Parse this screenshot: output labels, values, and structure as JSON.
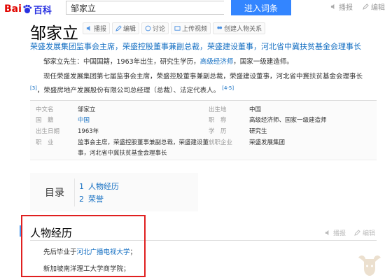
{
  "header": {
    "logo_bai": "Bai",
    "logo_baike": "百科",
    "search_value": "邹家立",
    "search_button": "进入词条",
    "actions": [
      "播报",
      "编辑"
    ]
  },
  "entry": {
    "title": "邹家立",
    "tools": [
      "播报",
      "编辑",
      "讨论",
      "上传视频",
      "创建人物关系"
    ],
    "subtitle": "荣盛发展集团监事会主席，荣盛控股董事兼副总裁，荣盛建设董事，河北省中冀扶贫基金会理事长",
    "para1_prefix": "邹家立先生：中国国籍，1963年出生，研究生学历，",
    "para1_link": "高级经济师",
    "para1_suffix": "，国家一级建造师。",
    "para2_text": "现任荣盛发展集团第七届监事会主席，荣盛控股董事兼副总裁，荣盛建设董事，河北省中冀扶贫基金会理事长",
    "para2_ref1": "[3]",
    "para2_text2": "，荣盛房地产发展股份有限公司总经理（总裁）、法定代表人。",
    "para2_ref2": "[4-5]"
  },
  "infobox": {
    "left": [
      {
        "label": "中文名",
        "value": "邹家立"
      },
      {
        "label": "国　籍",
        "value": "中国"
      },
      {
        "label": "出生日期",
        "value": "1963年"
      },
      {
        "label": "职　业",
        "value": "监事会主席，荣盛控股董事兼副总裁，荣盛建设董",
        "value2": "事，河北省中冀扶贫基金会理事长"
      }
    ],
    "right": [
      {
        "label": "出生地",
        "value": "中国"
      },
      {
        "label": "职　称",
        "value": "高级经济师、国家一级建造师"
      },
      {
        "label": "学　历",
        "value": "研究生"
      },
      {
        "label": "就职企业",
        "value": "荣盛发展集团"
      }
    ]
  },
  "catalog": {
    "title": "目录",
    "items": [
      {
        "num": "1",
        "label": "人物经历"
      },
      {
        "num": "2",
        "label": "荣誉"
      }
    ]
  },
  "section": {
    "title": "人物经历",
    "tools": [
      "播报",
      "编辑"
    ],
    "line1_prefix": "先后毕业于",
    "line1_link": "河北广播电视大学",
    "line1_suffix": "；",
    "line2": "新加坡南洋理工大学商学院；"
  }
}
